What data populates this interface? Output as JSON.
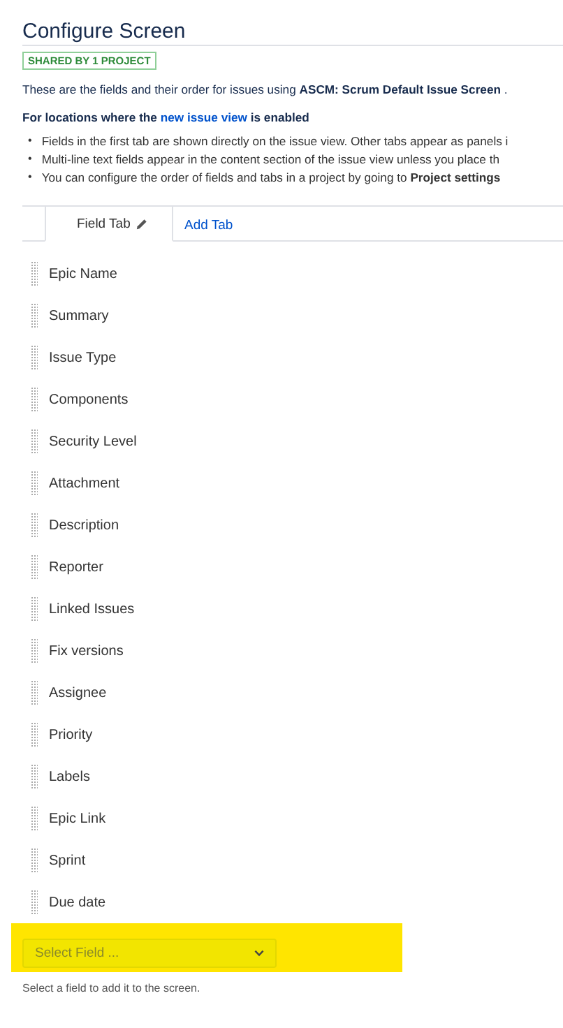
{
  "title": "Configure Screen",
  "badge": "SHARED BY 1 PROJECT",
  "intro": "These are the fields and their order for issues using **ASCM: Scrum Default Issue Screen** .",
  "section_heading": {
    "before": "For locations where the ",
    "link": "new issue view",
    "after": " is enabled"
  },
  "note_marker": "•",
  "notes": [
    "Fields in the first tab are shown directly on the issue view. Other tabs appear as panels i",
    "Multi-line text fields appear in the content section of the issue view unless you place th",
    "You can configure the order of fields and tabs in a project by going to **Project settings**"
  ],
  "tabs": [
    {
      "label": "Field Tab",
      "selected": true,
      "kind": "tab"
    },
    {
      "label": "Add Tab",
      "selected": false,
      "kind": "link"
    }
  ],
  "fields": [
    "Epic Name",
    "Summary",
    "Issue Type",
    "Components",
    "Security Level",
    "Attachment",
    "Description",
    "Reporter",
    "Linked Issues",
    "Fix versions",
    "Assignee",
    "Priority",
    "Labels",
    "Epic Link",
    "Sprint",
    "Due date"
  ],
  "add_field": {
    "placeholder": "Select Field ...",
    "highlighted": true,
    "hint": "Select a field to add it to the screen."
  }
}
